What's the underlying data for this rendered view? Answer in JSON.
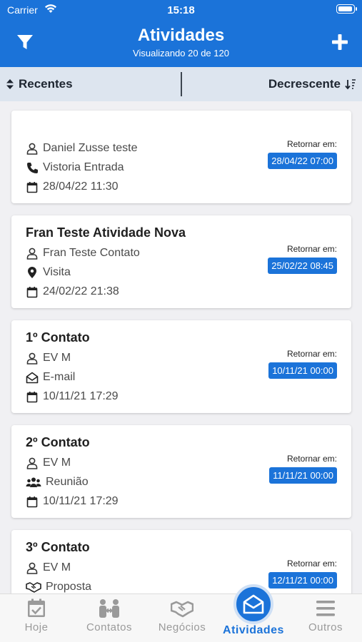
{
  "status": {
    "carrier": "Carrier",
    "time": "15:18"
  },
  "header": {
    "title": "Atividades",
    "subtitle": "Visualizando 20 de 120"
  },
  "sort": {
    "left_label": "Recentes",
    "right_label": "Decrescente"
  },
  "return_label": "Retornar em:",
  "cards": [
    {
      "title": "",
      "contact": "Daniel Zusse teste",
      "type": "Vistoria Entrada",
      "type_icon": "phone-icon",
      "date": "28/04/22 11:30",
      "return_date": "28/04/22 07:00"
    },
    {
      "title": "Fran Teste Atividade Nova",
      "contact": "Fran Teste Contato",
      "type": "Visita",
      "type_icon": "map-pin-icon",
      "date": "24/02/22 21:38",
      "return_date": "25/02/22 08:45"
    },
    {
      "title": "1º Contato",
      "contact": "EV M",
      "type": "E-mail",
      "type_icon": "envelope-open-icon",
      "date": "10/11/21 17:29",
      "return_date": "10/11/21 00:00"
    },
    {
      "title": "2º Contato",
      "contact": "EV M",
      "type": "Reunião",
      "type_icon": "users-icon",
      "date": "10/11/21 17:29",
      "return_date": "11/11/21 00:00"
    },
    {
      "title": "3º Contato",
      "contact": "EV M",
      "type": "Proposta",
      "type_icon": "handshake-icon",
      "date": "",
      "return_date": "12/11/21 00:00"
    }
  ],
  "tabs": [
    {
      "label": "Hoje",
      "icon": "calendar-check-icon"
    },
    {
      "label": "Contatos",
      "icon": "contacts-icon"
    },
    {
      "label": "Negócios",
      "icon": "handshake-icon"
    },
    {
      "label": "Atividades",
      "icon": "envelope-open-icon",
      "active": true
    },
    {
      "label": "Outros",
      "icon": "menu-icon"
    }
  ],
  "colors": {
    "primary": "#1b73d9",
    "sortbar": "#dde5ef",
    "background": "#f0f0f3"
  }
}
